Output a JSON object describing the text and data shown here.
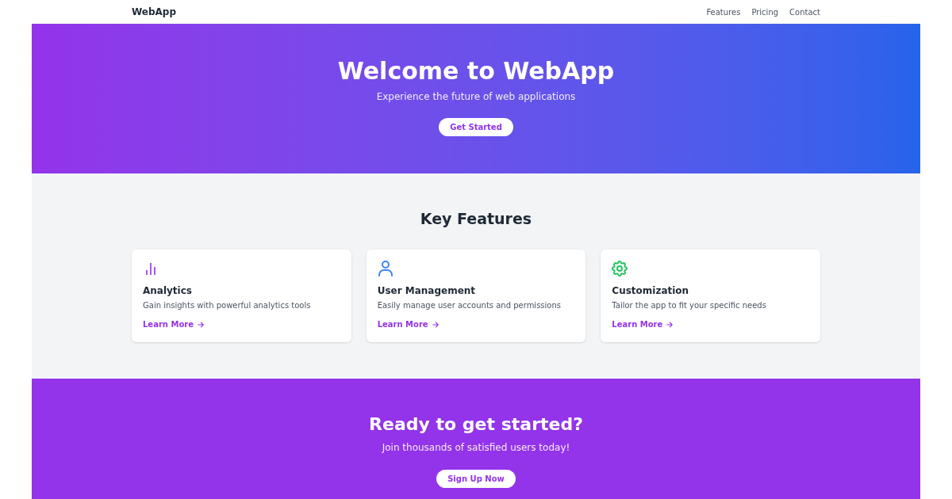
{
  "nav": {
    "brand": "WebApp",
    "links": [
      "Features",
      "Pricing",
      "Contact"
    ]
  },
  "hero": {
    "title": "Welcome to WebApp",
    "subtitle": "Experience the future of web applications",
    "button": "Get Started"
  },
  "features": {
    "heading": "Key Features",
    "cards": [
      {
        "kind": "chart",
        "color": "#a855f7",
        "title": "Analytics",
        "description": "Gain insights with powerful analytics tools",
        "link": "Learn More"
      },
      {
        "kind": "user",
        "color": "#3b82f6",
        "title": "User Management",
        "description": "Easily manage user accounts and permissions",
        "link": "Learn More"
      },
      {
        "kind": "gear",
        "color": "#22c55e",
        "title": "Customization",
        "description": "Tailor the app to fit your specific needs",
        "link": "Learn More"
      }
    ]
  },
  "cta": {
    "title": "Ready to get started?",
    "subtitle": "Join thousands of satisfied users today!",
    "button": "Sign Up Now"
  }
}
